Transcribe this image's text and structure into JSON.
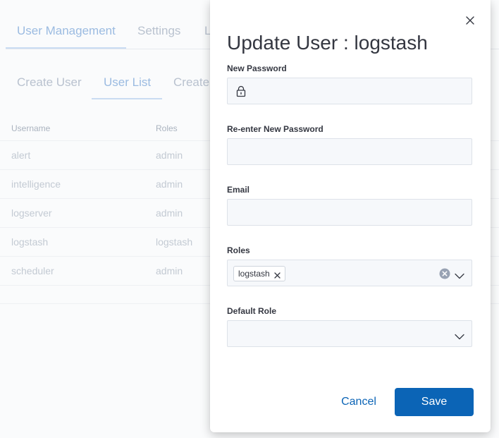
{
  "background": {
    "tabs": [
      "User Management",
      "Settings",
      "L"
    ],
    "sub_tabs": [
      "Create User",
      "User List",
      "Create"
    ],
    "table": {
      "columns": [
        "Username",
        "Roles"
      ],
      "rows": [
        {
          "username": "alert",
          "role": "admin"
        },
        {
          "username": "intelligence",
          "role": "admin"
        },
        {
          "username": "logserver",
          "role": "admin"
        },
        {
          "username": "logstash",
          "role": "logstash"
        },
        {
          "username": "scheduler",
          "role": "admin"
        }
      ]
    }
  },
  "flyout": {
    "title": "Update User : logstash",
    "fields": {
      "new_password": {
        "label": "New Password",
        "value": "",
        "icon": "lock-icon"
      },
      "reenter_password": {
        "label": "Re-enter New Password",
        "value": ""
      },
      "email": {
        "label": "Email",
        "value": ""
      },
      "roles": {
        "label": "Roles",
        "selected": [
          "logstash"
        ]
      },
      "default_role": {
        "label": "Default Role",
        "value": ""
      }
    },
    "cancel_label": "Cancel",
    "save_label": "Save"
  },
  "colors": {
    "accent": "#0b64b6",
    "title": "#343741",
    "muted": "#c3cad3"
  }
}
